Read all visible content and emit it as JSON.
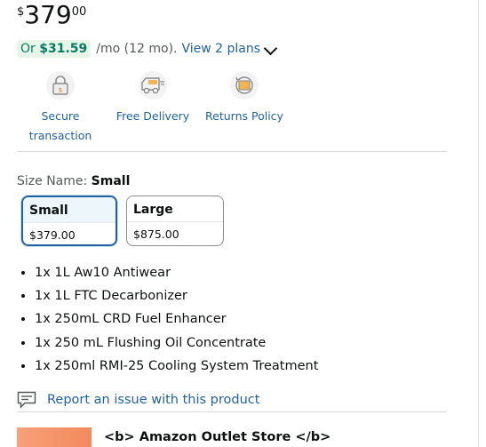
{
  "price": {
    "symbol": "$",
    "whole": "379",
    "fraction": "00"
  },
  "installment": {
    "prefix": "Or ",
    "amount": "$31.59",
    "terms": "/mo (12 mo).",
    "link": "View 2 plans"
  },
  "badges": [
    {
      "icon": "lock-icon",
      "label": "Secure transaction"
    },
    {
      "icon": "delivery-truck-icon",
      "label": "Free Delivery"
    },
    {
      "icon": "returns-icon",
      "label": "Returns Policy"
    }
  ],
  "size": {
    "label": "Size Name:",
    "selected": "Small",
    "options": [
      {
        "name": "Small",
        "price": "$379.00"
      },
      {
        "name": "Large",
        "price": "$875.00"
      }
    ]
  },
  "bullets": [
    "1x 1L Aw10 Antiwear",
    "1x 1L FTC Decarbonizer",
    "1x 250mL CRD Fuel Enhancer",
    "1x 250 mL Flushing Oil Concentrate",
    "1x 250ml RMI-25 Cooling System Treatment"
  ],
  "report": {
    "label": "Report an issue with this product"
  },
  "store": {
    "name": "<b> Amazon Outlet Store </b>"
  },
  "colors": {
    "link": "#2162A1",
    "green": "#067D62",
    "selected_border": "#2162A1"
  }
}
